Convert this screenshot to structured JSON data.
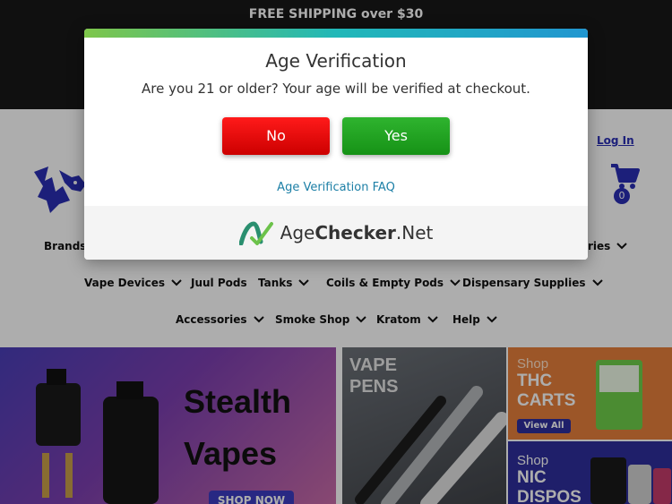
{
  "topbar": {
    "shipping": "FREE SHIPPING over $30"
  },
  "header": {
    "login": "Log In",
    "cart_count": "0",
    "logo_icon": "wolf-mascot-logo",
    "cart_icon": "shopping-cart-icon"
  },
  "nav": {
    "row1": [
      {
        "label": "Brands"
      },
      {
        "label": "ries"
      }
    ],
    "row2": [
      {
        "label": "Vape Devices",
        "has_dropdown": true
      },
      {
        "label": "Juul Pods",
        "has_dropdown": false
      },
      {
        "label": "Tanks",
        "has_dropdown": true
      },
      {
        "label": "Coils & Empty Pods",
        "has_dropdown": true
      },
      {
        "label": "Dispensary Supplies",
        "has_dropdown": true
      }
    ],
    "row3": [
      {
        "label": "Accessories",
        "has_dropdown": true
      },
      {
        "label": "Smoke Shop",
        "has_dropdown": true
      },
      {
        "label": "Kratom",
        "has_dropdown": true
      },
      {
        "label": "Help",
        "has_dropdown": true
      }
    ]
  },
  "banners": {
    "stealth": {
      "line1": "Stealth",
      "line2": "Vapes",
      "cta": "SHOP NOW"
    },
    "pens": {
      "line1": "VAPE",
      "line2": "PENS"
    },
    "thc": {
      "shop": "Shop",
      "line1": "THC",
      "line2": "CARTS",
      "cta": "View All"
    },
    "nic": {
      "shop": "Shop",
      "line1": "NIC",
      "line2": "DISPOS"
    }
  },
  "modal": {
    "title": "Age Verification",
    "question": "Are you 21 or older? Your age will be verified at checkout.",
    "no_label": "No",
    "yes_label": "Yes",
    "faq_link": "Age Verification FAQ",
    "brand_prefix": "Age",
    "brand_bold": "Checker",
    "brand_suffix": ".Net",
    "colors": {
      "no": "#e00000",
      "yes": "#1fa11f",
      "link": "#1c7fa6"
    }
  }
}
